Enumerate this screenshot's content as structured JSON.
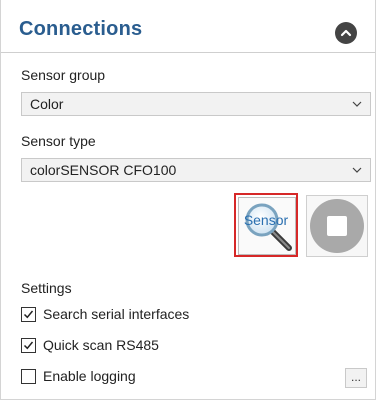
{
  "panel": {
    "title": "Connections"
  },
  "sensor_group": {
    "label": "Sensor group",
    "value": "Color"
  },
  "sensor_type": {
    "label": "Sensor type",
    "value": "colorSENSOR CFO100"
  },
  "buttons": {
    "sensor_search_text": "Sensor",
    "ellipsis": "..."
  },
  "settings": {
    "label": "Settings",
    "options": [
      {
        "label": "Search serial interfaces",
        "checked": true
      },
      {
        "label": "Quick scan RS485",
        "checked": true
      },
      {
        "label": "Enable logging",
        "checked": false
      }
    ]
  },
  "colors": {
    "title": "#2a5d8f",
    "highlight_border": "#d62828"
  },
  "icons": {
    "collapse": "chevron-up-icon",
    "sensor_search": "magnifier-icon",
    "stop": "stop-icon",
    "dropdown": "chevron-down-icon",
    "check": "check-icon"
  }
}
